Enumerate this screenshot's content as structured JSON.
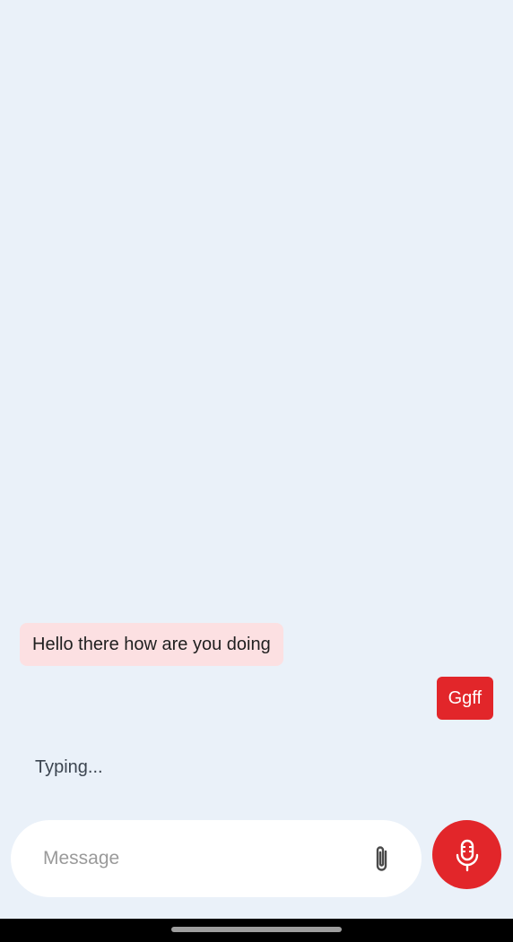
{
  "chat": {
    "messages": [
      {
        "direction": "received",
        "text": "Hello there how are you doing"
      },
      {
        "direction": "sent",
        "text": "Ggff"
      }
    ],
    "typing_indicator": "Typing..."
  },
  "composer": {
    "placeholder": "Message",
    "value": "",
    "attach_icon": "paperclip-icon",
    "mic_icon": "microphone-icon"
  },
  "colors": {
    "background": "#eaf1f9",
    "accent": "#e2262a",
    "received_bubble": "#fce0e2"
  }
}
